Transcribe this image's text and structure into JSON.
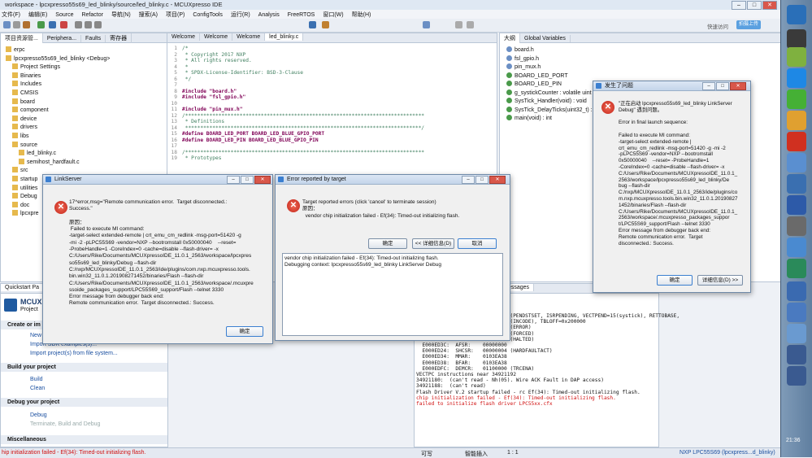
{
  "window": {
    "title": "workspace - lpcxpresso55s69_led_blinky/source/led_blinky.c - MCUXpresso IDE"
  },
  "menubar": [
    "文件(F)",
    "编辑(E)",
    "Source",
    "Refactor",
    "导航(N)",
    "搜索(A)",
    "项目(P)",
    "ConfigTools",
    "运行(R)",
    "Analysis",
    "FreeRTOS",
    "窗口(W)",
    "帮助(H)"
  ],
  "toolbar": {
    "quick_access": "快速访问",
    "cloud_label": "拍摄上传"
  },
  "left_panel": {
    "tabs": [
      "项目资源管...",
      "Periphera...",
      "Faults",
      "寄存器",
      "Global Variables"
    ],
    "tree": [
      "erpc",
      "lpcxpresso55s69_led_blinky <Debug>",
      "Project Settings",
      "Binaries",
      "Includes",
      "CMSIS",
      "board",
      "component",
      "device",
      "drivers",
      "libs",
      "source",
      "led_blinky.c",
      "semihost_hardfault.c",
      "src",
      "startup",
      "utilities",
      "Debug",
      "doc",
      "lpcxpre"
    ]
  },
  "editor": {
    "tabs": [
      "Welcome",
      "Welcome",
      "Welcome",
      "led_blinky.c"
    ],
    "lines": [
      {
        "n": "1",
        "t": "/*",
        "c": "cmt"
      },
      {
        "n": "2",
        "t": " * Copyright 2017 NXP",
        "c": "cmt"
      },
      {
        "n": "3",
        "t": " * All rights reserved.",
        "c": "cmt"
      },
      {
        "n": "4",
        "t": " *",
        "c": "cmt"
      },
      {
        "n": "5",
        "t": " * SPDX-License-Identifier: BSD-3-Clause",
        "c": "cmt"
      },
      {
        "n": "6",
        "t": " */",
        "c": "cmt"
      },
      {
        "n": "7",
        "t": "",
        "c": ""
      },
      {
        "n": "8",
        "t": "#include \"board.h\"",
        "c": "kw"
      },
      {
        "n": "9",
        "t": "#include \"fsl_gpio.h\"",
        "c": "kw"
      },
      {
        "n": "10",
        "t": "",
        "c": ""
      },
      {
        "n": "11",
        "t": "#include \"pin_mux.h\"",
        "c": "kw"
      },
      {
        "n": "12",
        "t": "/*******************************************************************************",
        "c": "cmt"
      },
      {
        "n": "13",
        "t": " * Definitions",
        "c": "cmt"
      },
      {
        "n": "14",
        "t": " ******************************************************************************/",
        "c": "cmt"
      },
      {
        "n": "15",
        "t": "#define BOARD_LED_PORT BOARD_LED_BLUE_GPIO_PORT",
        "c": "kw"
      },
      {
        "n": "16",
        "t": "#define BOARD_LED_PIN BOARD_LED_BLUE_GPIO_PIN",
        "c": "kw"
      },
      {
        "n": "17",
        "t": "",
        "c": ""
      },
      {
        "n": "18",
        "t": "/*******************************************************************************",
        "c": "cmt"
      },
      {
        "n": "19",
        "t": " * Prototypes",
        "c": "cmt"
      }
    ]
  },
  "outline": {
    "tabs": [
      "大纲",
      "Global Variables"
    ],
    "items": [
      "board.h",
      "fsl_gpio.h",
      "pin_mux.h",
      "BOARD_LED_PORT",
      "BOARD_LED_PIN",
      "g_systickCounter : volatile uint",
      "SysTick_Handler(void) : void",
      "SysTick_DelayTicks(uint32_t) :",
      "main(void) : int"
    ]
  },
  "quickstart": {
    "tab": "Quickstart Pa",
    "brand": "MCUX",
    "brand_sub": "Project",
    "sections": {
      "create": "Create or im",
      "build": "Build your project",
      "debug": "Debug your project",
      "misc": "Miscellaneous"
    },
    "items": {
      "new": "New",
      "import_sdk": "Import SDK examples(s)...",
      "import_fs": "Import project(s) from file system...",
      "build": "Build",
      "clean": "Clean",
      "debug": "Debug",
      "terminate": "Terminate, Build and Debug"
    }
  },
  "console": {
    "tabs": [
      "Terminal",
      "Image Info",
      "Debug messages"
    ],
    "lines": [
      {
        "t": "  E000ED04:  ICSR:    00000000 (PENDSTSET, ISRPENDING, VECTPEND=15(systick), RETTOBASE,",
        "red": false
      },
      {
        "t": "                      BFLBASE=0(INCODE), TBLOFF=0x200000",
        "red": false
      },
      {
        "t": "  E000ED28:  CFSR:    00000000 (ERROR)",
        "red": false
      },
      {
        "t": "  E000ED2C:  HFSR:    40000000 (FORCED)",
        "red": false
      },
      {
        "t": "  E000ED30:  DFSR:    00000001 (HALTED)",
        "red": false
      },
      {
        "t": "  E000ED3C:  AFSR:    00000000",
        "red": false
      },
      {
        "t": "  E000ED24:  SHCSR:   00000004 (HARDFAULTACT)",
        "red": false
      },
      {
        "t": "  E000ED34:  MMAR:    0103EA38",
        "red": false
      },
      {
        "t": "  E000ED38:  BFAR:    0103EA38",
        "red": false
      },
      {
        "t": "  E000EDFC:  DEMCR:   01100000 (TRCENA)",
        "red": false
      },
      {
        "t": "VECTPC instructions near 34921192",
        "red": false
      },
      {
        "t": "34921180:  (can't read - Nh(05). Wire ACK Fault in DAP access)",
        "red": false
      },
      {
        "t": "34921188:  (can't read)",
        "red": false
      },
      {
        "t": "Flash Driver V.2 startup failed - rc Ef(34): Timed-out initializing flash.",
        "red": false
      },
      {
        "t": "chip initialization failed - Ef(34): Timed-out initializing flash.",
        "red": true
      },
      {
        "t": "failed to initialize flash driver LPC55xx.cfx",
        "red": true
      }
    ]
  },
  "dialog_linkserver": {
    "title": "LinkServer",
    "message": "17^error,msg=\"Remote communication error.  Target disconnected.:\nSuccess.\"\n\n原因：\n Failed to execute MI command:\n-target-select extended-remote | crt_emu_cm_redlink -msg-port=51420 -g\n-mi -2 -pLPC55S69 -vendor=NXP --bootromstall 0x50000040    --reset=\n-ProbeHandle=1 -CoreIndex=0 -cache=disable --flash-driver= -x\nC:/Users/Rike/Documents/MCUXpressoIDE_11.0.1_2563/workspace/lpcxpres\nso55s69_led_blinky/Debug --flash-dir\nC:/nxp/MCUXpressoIDE_11.0.1_2563/ide/plugins/com.nxp.mcuxpresso.tools.\nbin.win32_11.0.1.201908271452/binaries/Flash --flash-dir\nC:/Users/Rike/Documents/MCUXpressoIDE_11.0.1_2563/workspace/.mcuxpre\nssoide_packages_support/LPC55S69_support/Flash --telnet 3330\nError message from debugger back end:\nRemote communication error.  Target disconnected.: Success.",
    "ok": "确定"
  },
  "dialog_target": {
    "title": "Error reported by target",
    "message": "Target reported errors (click 'cancel' to terminate session)\n原因：\n  vendor chip initialization failed - Ef(34): Timed-out initializing flash.",
    "ok": "确定",
    "details": "<< 详细信息(D)",
    "cancel": "取消",
    "detail_text": "vendor chip initialization failed - Ef(34): Timed-out initializing flash.\nDebugging context: lpcxpresso55s69_led_blinky LinkServer Debug"
  },
  "dialog_problem": {
    "title": "发生了问题",
    "message": "\"正在启动 lpcxpresso55s69_led_blinky LinkServer\nDebug\" 遇到问题。\n\nError in final launch sequence:\n\nFailed to execute MI command:\n-target-select extended-remote |\ncrt_emu_cm_redlink -msg-port=51420 -g -mi -2\n-pLPC55S69 -vendor=NXP --bootromstall\n0x50000040    --reset= -ProbeHandle=1\n-CoreIndex=0 -cache=disable --flash-driver= -x\nC:/Users/Rike/Documents/MCUXpressoIDE_11.0.1_\n2563/workspace/lpcxpresso55s69_led_blinky/De\nbug --flash-dir\nC:/nxp/MCUXpressoIDE_11.0.1_2563/ide/plugins/co\nm.nxp.mcuxpresso.tools.bin.win32_11.0.1.20190827\n1452/binaries/Flash --flash-dir\nC:/Users/Rike/Documents/MCUXpressoIDE_11.0.1_\n2563/workspace/.mcuxpresso_packages_suppor\nt/LPC55S69_support/Flash --telnet 3330\nError message from debugger back end:\nRemote communication error.  Target\ndisconnected.: Success.",
    "ok": "确定",
    "details": "详细信息(D) >>"
  },
  "statusbar": {
    "error": "hip initialization failed - Ef(34): Timed-out initializing flash.",
    "writable": "可写",
    "insert": "智能插入",
    "position": "1 : 1",
    "target": "NXP LPC55S69 (lpcxpress...d_blinky)"
  },
  "taskbar": {
    "clock": "21:36"
  }
}
